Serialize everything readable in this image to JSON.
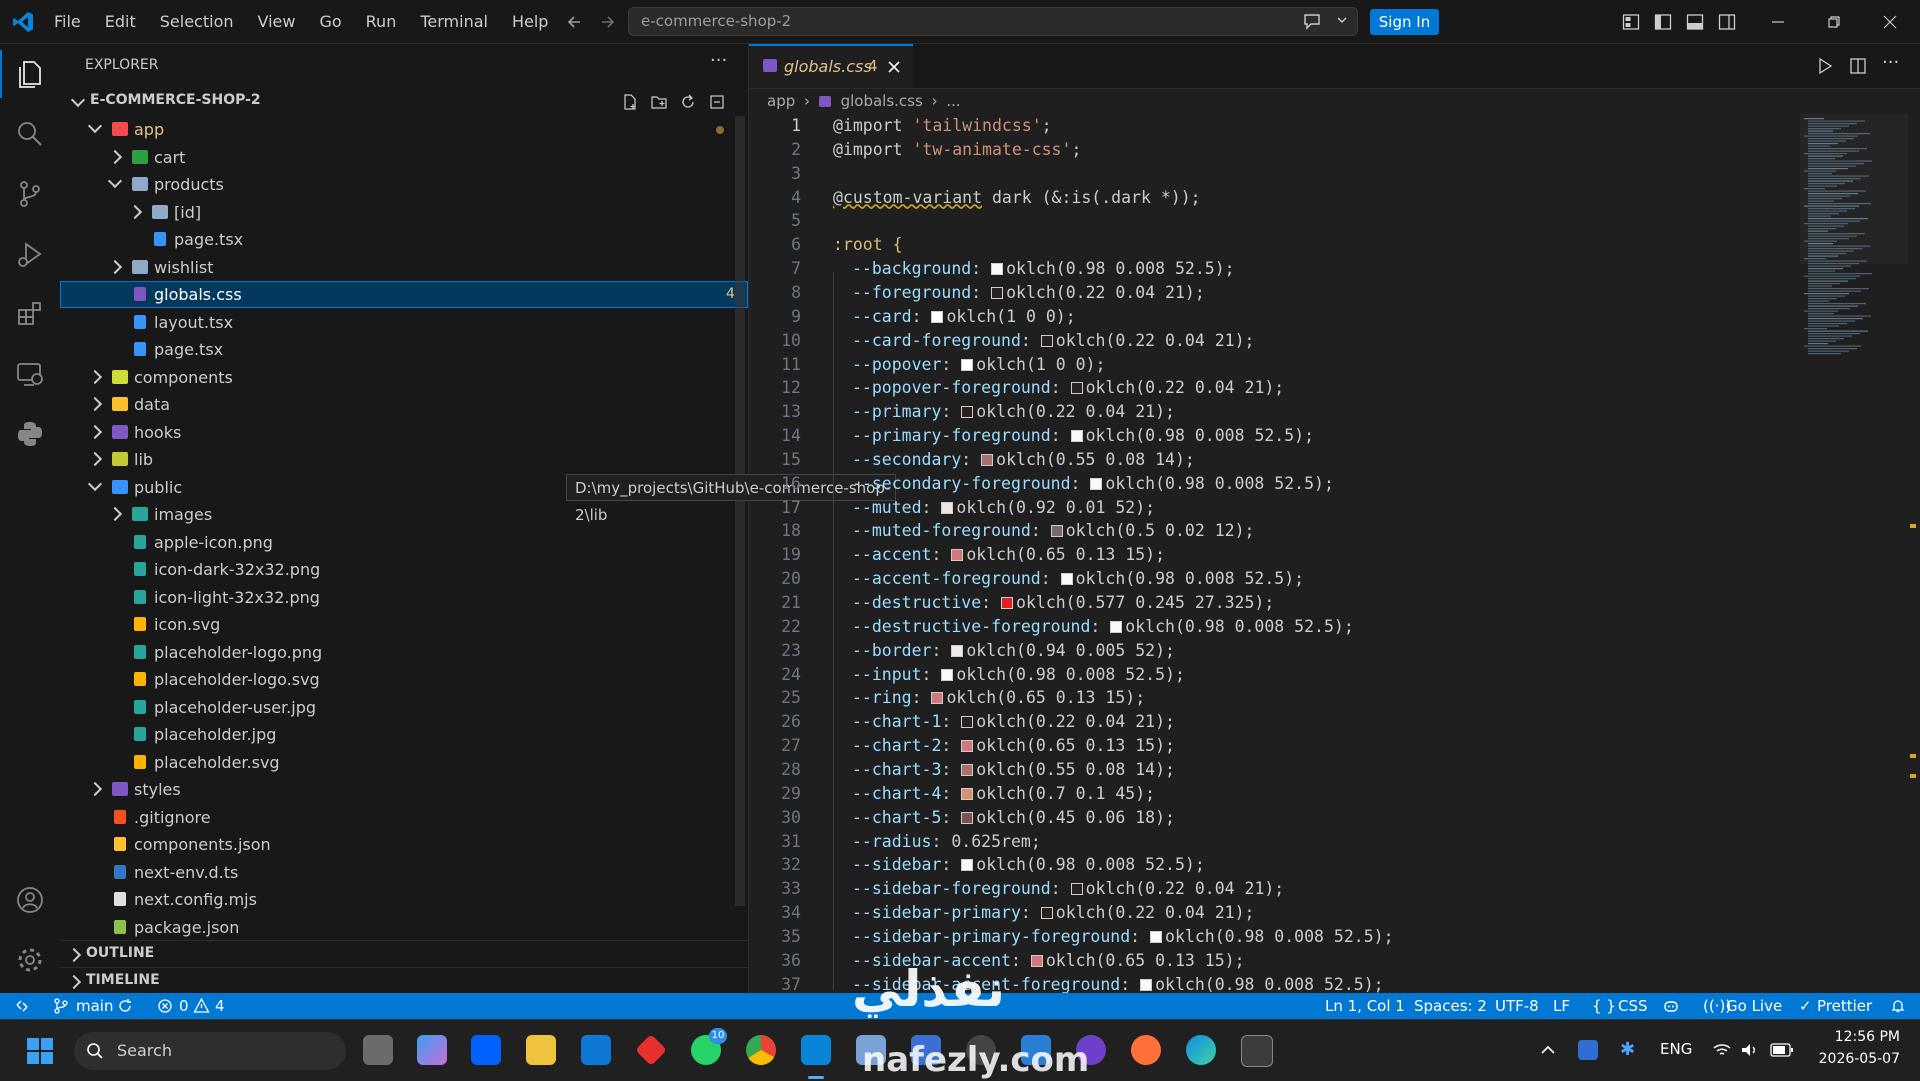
{
  "menu": [
    "File",
    "Edit",
    "Selection",
    "View",
    "Go",
    "Run",
    "Terminal",
    "Help"
  ],
  "command_center": "e-commerce-shop-2",
  "signin_label": "Sign In",
  "explorer": {
    "title": "EXPLORER",
    "project": "E-COMMERCE-SHOP-2",
    "items": [
      {
        "label": "app",
        "level": 0,
        "type": "folder",
        "open": true,
        "color": "#f14c4c",
        "modified": true
      },
      {
        "label": "cart",
        "level": 1,
        "type": "folder",
        "open": false,
        "color": "#2ea043"
      },
      {
        "label": "products",
        "level": 1,
        "type": "folder",
        "open": true,
        "color": "#8fa9c7"
      },
      {
        "label": "[id]",
        "level": 2,
        "type": "folder",
        "open": false,
        "color": "#8fa9c7"
      },
      {
        "label": "page.tsx",
        "level": 2,
        "type": "file",
        "color": "#3794ff"
      },
      {
        "label": "wishlist",
        "level": 1,
        "type": "folder",
        "open": false,
        "color": "#8fa9c7"
      },
      {
        "label": "globals.css",
        "level": 1,
        "type": "file",
        "color": "#7e57c2",
        "selected": true,
        "badge": "4"
      },
      {
        "label": "layout.tsx",
        "level": 1,
        "type": "file",
        "color": "#3794ff"
      },
      {
        "label": "page.tsx",
        "level": 1,
        "type": "file",
        "color": "#3794ff"
      },
      {
        "label": "components",
        "level": 0,
        "type": "folder",
        "open": false,
        "color": "#cddc39"
      },
      {
        "label": "data",
        "level": 0,
        "type": "folder",
        "open": false,
        "color": "#fbc02d"
      },
      {
        "label": "hooks",
        "level": 0,
        "type": "folder",
        "open": false,
        "color": "#7e57c2"
      },
      {
        "label": "lib",
        "level": 0,
        "type": "folder",
        "open": false,
        "color": "#c0ca33"
      },
      {
        "label": "public",
        "level": 0,
        "type": "folder",
        "open": true,
        "color": "#3794ff"
      },
      {
        "label": "images",
        "level": 1,
        "type": "folder",
        "open": false,
        "color": "#26a69a"
      },
      {
        "label": "apple-icon.png",
        "level": 1,
        "type": "file",
        "color": "#26a69a"
      },
      {
        "label": "icon-dark-32x32.png",
        "level": 1,
        "type": "file",
        "color": "#26a69a"
      },
      {
        "label": "icon-light-32x32.png",
        "level": 1,
        "type": "file",
        "color": "#26a69a"
      },
      {
        "label": "icon.svg",
        "level": 1,
        "type": "file",
        "color": "#ffb300"
      },
      {
        "label": "placeholder-logo.png",
        "level": 1,
        "type": "file",
        "color": "#26a69a"
      },
      {
        "label": "placeholder-logo.svg",
        "level": 1,
        "type": "file",
        "color": "#ffb300"
      },
      {
        "label": "placeholder-user.jpg",
        "level": 1,
        "type": "file",
        "color": "#26a69a"
      },
      {
        "label": "placeholder.jpg",
        "level": 1,
        "type": "file",
        "color": "#26a69a"
      },
      {
        "label": "placeholder.svg",
        "level": 1,
        "type": "file",
        "color": "#ffb300"
      },
      {
        "label": "styles",
        "level": 0,
        "type": "folder",
        "open": false,
        "color": "#7e57c2"
      },
      {
        "label": ".gitignore",
        "level": 0,
        "type": "file",
        "color": "#f4511e"
      },
      {
        "label": "components.json",
        "level": 0,
        "type": "file",
        "color": "#fbc02d"
      },
      {
        "label": "next-env.d.ts",
        "level": 0,
        "type": "file",
        "color": "#3178c6"
      },
      {
        "label": "next.config.mjs",
        "level": 0,
        "type": "file",
        "color": "#e0e0e0"
      },
      {
        "label": "package.json",
        "level": 0,
        "type": "file",
        "color": "#8bc34a"
      }
    ],
    "outline": "OUTLINE",
    "timeline": "TIMELINE"
  },
  "tooltip": "D:\\my_projects\\GitHub\\e-commerce-shop-2\\lib",
  "tab": {
    "name": "globals.css",
    "count": "4"
  },
  "breadcrumb": {
    "folder": "app",
    "file": "globals.css",
    "rest": "..."
  },
  "code_lines": [
    {
      "n": 1,
      "parts": [
        [
          "@import ",
          "#cccccc"
        ],
        [
          "'tailwindcss'",
          "#ce9178"
        ],
        [
          ";",
          "#cccccc"
        ]
      ]
    },
    {
      "n": 2,
      "parts": [
        [
          "@import ",
          "#cccccc"
        ],
        [
          "'tw-animate-css'",
          "#ce9178"
        ],
        [
          ";",
          "#cccccc"
        ]
      ]
    },
    {
      "n": 3,
      "parts": []
    },
    {
      "n": 4,
      "parts": [
        [
          "@custom-variant",
          "#cccccc"
        ],
        [
          " dark (&:is(.dark *));",
          "#cccccc"
        ]
      ]
    },
    {
      "n": 5,
      "parts": []
    },
    {
      "n": 6,
      "parts": [
        [
          ":root {",
          "#d7ba7d"
        ]
      ]
    },
    {
      "n": 7,
      "prop": "--background",
      "swatch": "#fafafa",
      "val": "oklch(0.98 0.008 52.5);"
    },
    {
      "n": 8,
      "prop": "--foreground",
      "swatch": "#2b2220",
      "val": "oklch(0.22 0.04 21);"
    },
    {
      "n": 9,
      "prop": "--card",
      "swatch": "#ffffff",
      "val": "oklch(1 0 0);"
    },
    {
      "n": 10,
      "prop": "--card-foreground",
      "swatch": "#2b2220",
      "val": "oklch(0.22 0.04 21);"
    },
    {
      "n": 11,
      "prop": "--popover",
      "swatch": "#ffffff",
      "val": "oklch(1 0 0);"
    },
    {
      "n": 12,
      "prop": "--popover-foreground",
      "swatch": "#2b2220",
      "val": "oklch(0.22 0.04 21);"
    },
    {
      "n": 13,
      "prop": "--primary",
      "swatch": "#2b2220",
      "val": "oklch(0.22 0.04 21);"
    },
    {
      "n": 14,
      "prop": "--primary-foreground",
      "swatch": "#fafafa",
      "val": "oklch(0.98 0.008 52.5);"
    },
    {
      "n": 15,
      "prop": "--secondary",
      "swatch": "#a8706c",
      "val": "oklch(0.55 0.08 14);"
    },
    {
      "n": 16,
      "prop": "--secondary-foreground",
      "swatch": "#fafafa",
      "val": "oklch(0.98 0.008 52.5);"
    },
    {
      "n": 17,
      "prop": "--muted",
      "swatch": "#ede6e3",
      "val": "oklch(0.92 0.01 52);"
    },
    {
      "n": 18,
      "prop": "--muted-foreground",
      "swatch": "#7a6b68",
      "val": "oklch(0.5 0.02 12);"
    },
    {
      "n": 19,
      "prop": "--accent",
      "swatch": "#d4777c",
      "val": "oklch(0.65 0.13 15);"
    },
    {
      "n": 20,
      "prop": "--accent-foreground",
      "swatch": "#fafafa",
      "val": "oklch(0.98 0.008 52.5);"
    },
    {
      "n": 21,
      "prop": "--destructive",
      "swatch": "#e02020",
      "val": "oklch(0.577 0.245 27.325);"
    },
    {
      "n": 22,
      "prop": "--destructive-foreground",
      "swatch": "#fafafa",
      "val": "oklch(0.98 0.008 52.5);"
    },
    {
      "n": 23,
      "prop": "--border",
      "swatch": "#efebea",
      "val": "oklch(0.94 0.005 52);"
    },
    {
      "n": 24,
      "prop": "--input",
      "swatch": "#fafafa",
      "val": "oklch(0.98 0.008 52.5);"
    },
    {
      "n": 25,
      "prop": "--ring",
      "swatch": "#d4777c",
      "val": "oklch(0.65 0.13 15);"
    },
    {
      "n": 26,
      "prop": "--chart-1",
      "swatch": "#2b2220",
      "val": "oklch(0.22 0.04 21);"
    },
    {
      "n": 27,
      "prop": "--chart-2",
      "swatch": "#d4777c",
      "val": "oklch(0.65 0.13 15);"
    },
    {
      "n": 28,
      "prop": "--chart-3",
      "swatch": "#a8706c",
      "val": "oklch(0.55 0.08 14);"
    },
    {
      "n": 29,
      "prop": "--chart-4",
      "swatch": "#d9906e",
      "val": "oklch(0.7 0.1 45);"
    },
    {
      "n": 30,
      "prop": "--chart-5",
      "swatch": "#7a5550",
      "val": "oklch(0.45 0.06 18);"
    },
    {
      "n": 31,
      "prop": "--radius",
      "swatch": "",
      "val": "0.625rem;"
    },
    {
      "n": 32,
      "prop": "--sidebar",
      "swatch": "#fafafa",
      "val": "oklch(0.98 0.008 52.5);"
    },
    {
      "n": 33,
      "prop": "--sidebar-foreground",
      "swatch": "#2b2220",
      "val": "oklch(0.22 0.04 21);"
    },
    {
      "n": 34,
      "prop": "--sidebar-primary",
      "swatch": "#2b2220",
      "val": "oklch(0.22 0.04 21);"
    },
    {
      "n": 35,
      "prop": "--sidebar-primary-foreground",
      "swatch": "#fafafa",
      "val": "oklch(0.98 0.008 52.5);"
    },
    {
      "n": 36,
      "prop": "--sidebar-accent",
      "swatch": "#d4777c",
      "val": "oklch(0.65 0.13 15);"
    },
    {
      "n": 37,
      "prop": "--sidebar-accent-foreground",
      "swatch": "#fafafa",
      "val": "oklch(0.98 0.008 52.5);"
    }
  ],
  "status": {
    "branch": "main",
    "errors": "0",
    "warnings": "4",
    "position": "Ln 1, Col 1",
    "spaces": "Spaces: 2",
    "encoding": "UTF-8",
    "eol": "LF",
    "language": "CSS",
    "golive": "Go Live",
    "prettier": "Prettier"
  },
  "taskbar": {
    "search": "Search",
    "lang": "ENG",
    "time": "12:56 PM",
    "date": "2026-05-07",
    "whatsapp_badge": "10"
  },
  "watermark": {
    "arabic": "نفذلي",
    "latin": "nafezly.com"
  }
}
